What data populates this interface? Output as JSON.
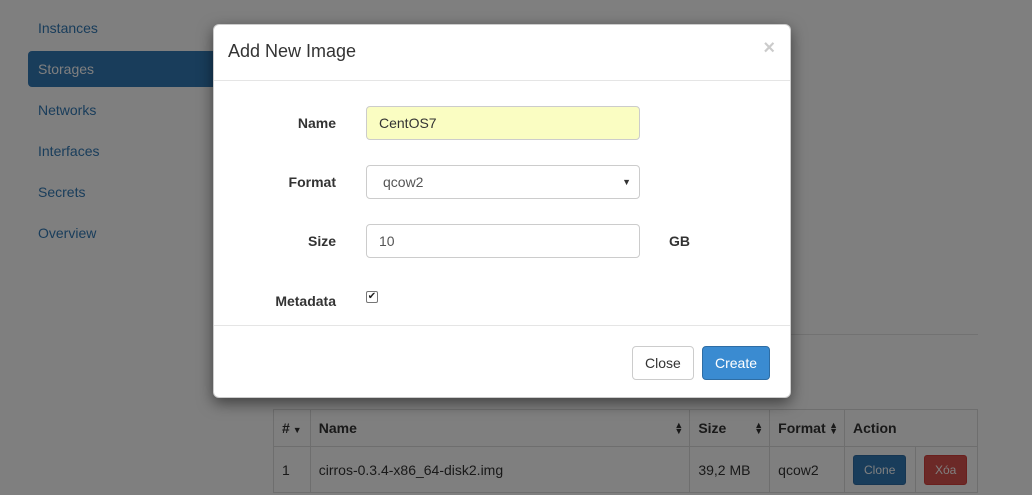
{
  "sidebar": {
    "items": [
      {
        "label": "Instances"
      },
      {
        "label": "Storages"
      },
      {
        "label": "Networks"
      },
      {
        "label": "Interfaces"
      },
      {
        "label": "Secrets"
      },
      {
        "label": "Overview"
      }
    ],
    "active_index": 1
  },
  "table": {
    "headers": [
      "#",
      "Name",
      "Size",
      "Format",
      "Action"
    ],
    "rows": [
      {
        "index": "1",
        "name": "cirros-0.3.4-x86_64-disk2.img",
        "size": "39,2 MB",
        "format": "qcow2",
        "clone_label": "Clone",
        "delete_label": "Xóa"
      }
    ]
  },
  "modal": {
    "title": "Add New Image",
    "close_symbol": "×",
    "fields": {
      "name": {
        "label": "Name",
        "value": "CentOS7"
      },
      "format": {
        "label": "Format",
        "value": "qcow2"
      },
      "size": {
        "label": "Size",
        "value": "10",
        "unit": "GB"
      },
      "metadata": {
        "label": "Metadata",
        "checked": true
      }
    },
    "footer": {
      "close_label": "Close",
      "create_label": "Create"
    }
  },
  "colors": {
    "primary": "#337ab7",
    "danger": "#d9534f",
    "name_highlight": "#fafdc2"
  }
}
